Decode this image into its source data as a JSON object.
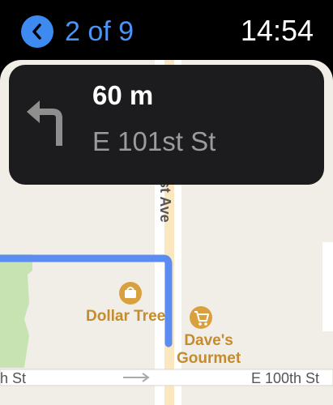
{
  "header": {
    "step_indicator": "2 of 9",
    "time": "14:54"
  },
  "navigation": {
    "distance": "60 m",
    "street": "E 101st St",
    "maneuver": "turn-left"
  },
  "map": {
    "avenue_label": "st Ave",
    "street_left_label": "h St",
    "street_right_label": "E 100th St",
    "pois": [
      {
        "name": "Dollar Tree",
        "icon": "shopping-bag-icon"
      },
      {
        "name": "Dave's\nGourmet",
        "icon": "shopping-cart-icon"
      }
    ]
  },
  "colors": {
    "accent": "#4c94f4",
    "route": "#5a8cf2",
    "poi": "#c48b2f",
    "card": "#1c1c1e"
  }
}
